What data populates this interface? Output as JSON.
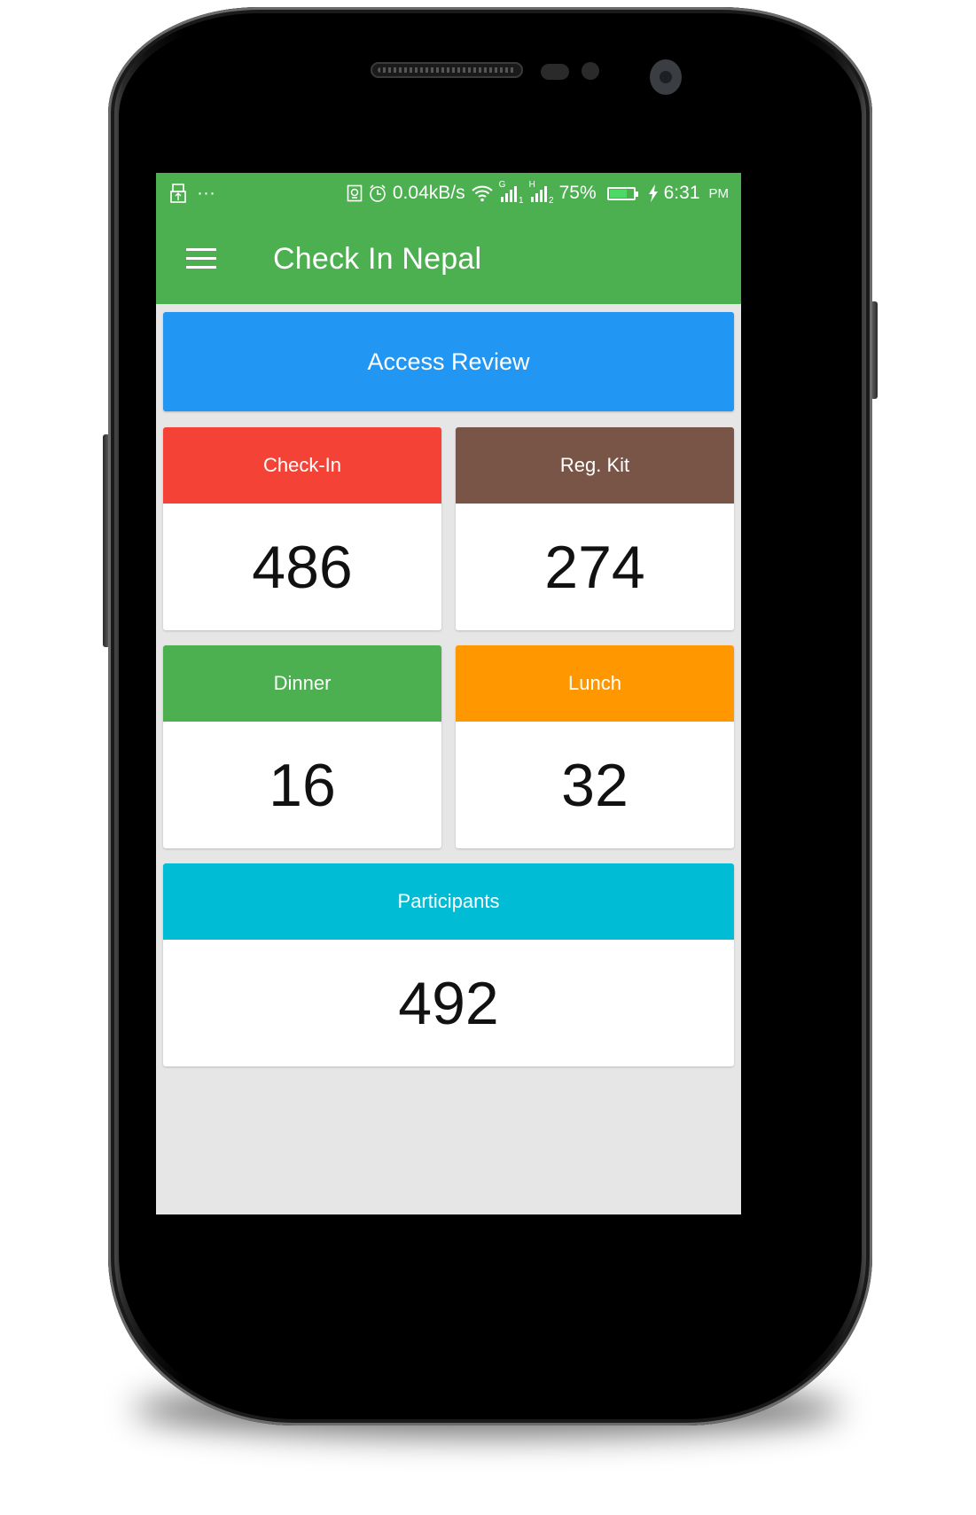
{
  "status_bar": {
    "left_icons": [
      "usb-icon",
      "more-dots-icon"
    ],
    "more_dots": "···",
    "net_speed": "0.04kB/s",
    "sim1_label": "G",
    "sim1_index": "1",
    "sim2_label": "H",
    "sim2_index": "2",
    "battery_percent_text": "75%",
    "battery_level": 0.75,
    "time": "6:31",
    "ampm": "PM"
  },
  "toolbar": {
    "title": "Check In Nepal",
    "menu_icon": "hamburger-menu-icon"
  },
  "access_review": {
    "label": "Access Review",
    "color": "#2196f3"
  },
  "cards": [
    {
      "label": "Check-In",
      "value": "486",
      "color": "#f44336"
    },
    {
      "label": "Reg. Kit",
      "value": "274",
      "color": "#795548"
    },
    {
      "label": "Dinner",
      "value": "16",
      "color": "#4caf50"
    },
    {
      "label": "Lunch",
      "value": "32",
      "color": "#ff9800"
    },
    {
      "label": "Participants",
      "value": "492",
      "color": "#00bcd4"
    }
  ],
  "theme": {
    "primary": "#4caf50",
    "background": "#e6e6e6"
  }
}
